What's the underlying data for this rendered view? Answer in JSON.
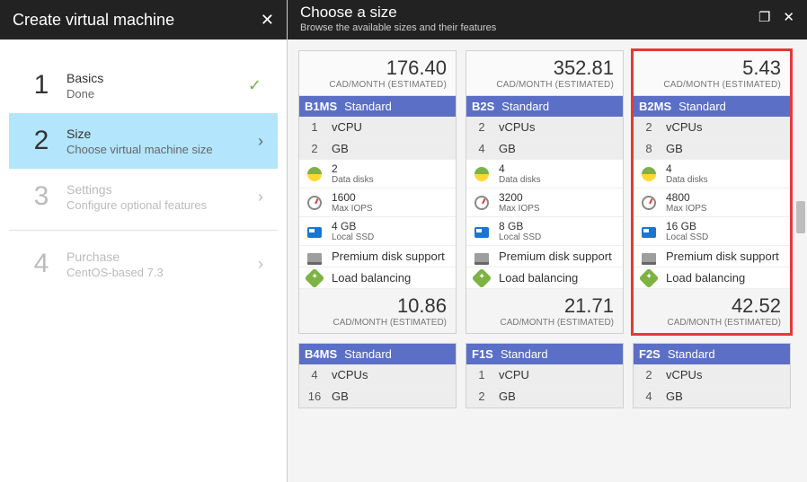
{
  "left": {
    "title": "Create virtual machine",
    "close": "✕",
    "steps": [
      {
        "num": "1",
        "main": "Basics",
        "sub": "Done",
        "state": "done"
      },
      {
        "num": "2",
        "main": "Size",
        "sub": "Choose virtual machine size",
        "state": "active"
      },
      {
        "num": "3",
        "main": "Settings",
        "sub": "Configure optional features",
        "state": "disabled"
      },
      {
        "num": "4",
        "main": "Purchase",
        "sub": "CentOS-based 7.3",
        "state": "disabled"
      }
    ]
  },
  "right": {
    "title": "Choose a size",
    "subtitle": "Browse the available sizes and their features",
    "restore": "❐",
    "close": "✕",
    "unit_label": "CAD/MONTH (ESTIMATED)",
    "cards": [
      {
        "top_price": "176.40",
        "sku": "B1MS",
        "tier": "Standard",
        "highlight": false,
        "vcpu_n": "1",
        "vcpu_l": "vCPU",
        "gb_n": "2",
        "gb_l": "GB",
        "disks_n": "2",
        "disks_l": "Data disks",
        "iops_n": "1600",
        "iops_l": "Max IOPS",
        "ssd_n": "4 GB",
        "ssd_l": "Local SSD",
        "premium": "Premium disk support",
        "lb": "Load balancing",
        "bottom_price": "10.86"
      },
      {
        "top_price": "352.81",
        "sku": "B2S",
        "tier": "Standard",
        "highlight": false,
        "vcpu_n": "2",
        "vcpu_l": "vCPUs",
        "gb_n": "4",
        "gb_l": "GB",
        "disks_n": "4",
        "disks_l": "Data disks",
        "iops_n": "3200",
        "iops_l": "Max IOPS",
        "ssd_n": "8 GB",
        "ssd_l": "Local SSD",
        "premium": "Premium disk support",
        "lb": "Load balancing",
        "bottom_price": "21.71"
      },
      {
        "top_price": "5.43",
        "sku": "B2MS",
        "tier": "Standard",
        "highlight": true,
        "vcpu_n": "2",
        "vcpu_l": "vCPUs",
        "gb_n": "8",
        "gb_l": "GB",
        "disks_n": "4",
        "disks_l": "Data disks",
        "iops_n": "4800",
        "iops_l": "Max IOPS",
        "ssd_n": "16 GB",
        "ssd_l": "Local SSD",
        "premium": "Premium disk support",
        "lb": "Load balancing",
        "bottom_price": "42.52"
      },
      {
        "sku": "B4MS",
        "tier": "Standard",
        "highlight": false,
        "vcpu_n": "4",
        "vcpu_l": "vCPUs",
        "gb_n": "16",
        "gb_l": "GB",
        "partial": true
      },
      {
        "sku": "F1S",
        "tier": "Standard",
        "highlight": false,
        "vcpu_n": "1",
        "vcpu_l": "vCPU",
        "gb_n": "2",
        "gb_l": "GB",
        "partial": true
      },
      {
        "sku": "F2S",
        "tier": "Standard",
        "highlight": false,
        "vcpu_n": "2",
        "vcpu_l": "vCPUs",
        "gb_n": "4",
        "gb_l": "GB",
        "partial": true
      }
    ]
  }
}
